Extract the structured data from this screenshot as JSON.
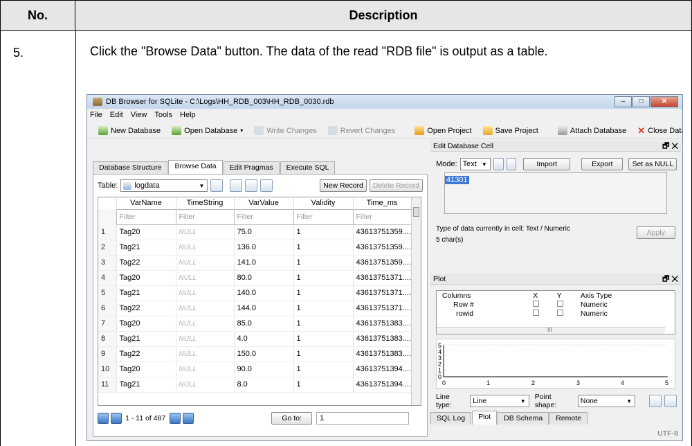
{
  "doc": {
    "col_no": "No.",
    "col_desc": "Description",
    "step_no": "5.",
    "step_text": "Click the \"Browse Data\" button. The data of the read \"RDB file\" is output as a table."
  },
  "app": {
    "title": "DB Browser for SQLite - C:\\Logs\\HH_RDB_003\\HH_RDB_0030.rdb",
    "menu": [
      "File",
      "Edit",
      "View",
      "Tools",
      "Help"
    ],
    "toolbar": {
      "new_db": "New Database",
      "open_db": "Open Database",
      "write": "Write Changes",
      "revert": "Revert Changes",
      "open_proj": "Open Project",
      "save_proj": "Save Project",
      "attach": "Attach Database",
      "close": "Close Database"
    },
    "tabs": [
      "Database Structure",
      "Browse Data",
      "Edit Pragmas",
      "Execute SQL"
    ],
    "table_label": "Table:",
    "table_name": "logdata",
    "new_record": "New Record",
    "delete_record": "Delete Record",
    "columns": [
      "VarName",
      "TimeString",
      "VarValue",
      "Validity",
      "Time_ms"
    ],
    "filter": "Filter",
    "rows": [
      [
        "1",
        "Tag20",
        "NULL",
        "75.0",
        "1",
        "43613751359...."
      ],
      [
        "2",
        "Tag21",
        "NULL",
        "136.0",
        "1",
        "43613751359...."
      ],
      [
        "3",
        "Tag22",
        "NULL",
        "141.0",
        "1",
        "43613751359...."
      ],
      [
        "4",
        "Tag20",
        "NULL",
        "80.0",
        "1",
        "43613751371...."
      ],
      [
        "5",
        "Tag21",
        "NULL",
        "140.0",
        "1",
        "43613751371...."
      ],
      [
        "6",
        "Tag22",
        "NULL",
        "144.0",
        "1",
        "43613751371...."
      ],
      [
        "7",
        "Tag20",
        "NULL",
        "85.0",
        "1",
        "43613751383...."
      ],
      [
        "8",
        "Tag21",
        "NULL",
        "4.0",
        "1",
        "43613751383...."
      ],
      [
        "9",
        "Tag22",
        "NULL",
        "150.0",
        "1",
        "43613751383...."
      ],
      [
        "10",
        "Tag20",
        "NULL",
        "90.0",
        "1",
        "43613751394...."
      ],
      [
        "11",
        "Tag21",
        "NULL",
        "8.0",
        "1",
        "43613751394...."
      ]
    ],
    "record_range": "1 - 11 of 487",
    "goto_label": "Go to:",
    "goto_value": "1",
    "edit_cell": {
      "title": "Edit Database Cell",
      "mode_label": "Mode:",
      "mode_value": "Text",
      "import": "Import",
      "export": "Export",
      "set_null": "Set as NULL",
      "value": "41301",
      "type_info": "Type of data currently in cell: Text / Numeric",
      "size_info": "5 char(s)",
      "apply": "Apply"
    },
    "plot": {
      "title": "Plot",
      "headers": [
        "Columns",
        "X",
        "Y",
        "Axis Type"
      ],
      "rows": [
        [
          "Row #",
          "Numeric"
        ],
        [
          "rowid",
          "Numeric"
        ]
      ],
      "hscroll_mark": "III",
      "y_ticks": [
        "5",
        "4",
        "3",
        "2",
        "1",
        "0"
      ],
      "x_ticks": [
        "0",
        "1",
        "2",
        "3",
        "4",
        "5"
      ],
      "line_type_label": "Line type:",
      "line_type_value": "Line",
      "point_shape_label": "Point shape:",
      "point_shape_value": "None"
    },
    "bottom_tabs": [
      "SQL Log",
      "Plot",
      "DB Schema",
      "Remote"
    ],
    "encoding": "UTF-8"
  }
}
